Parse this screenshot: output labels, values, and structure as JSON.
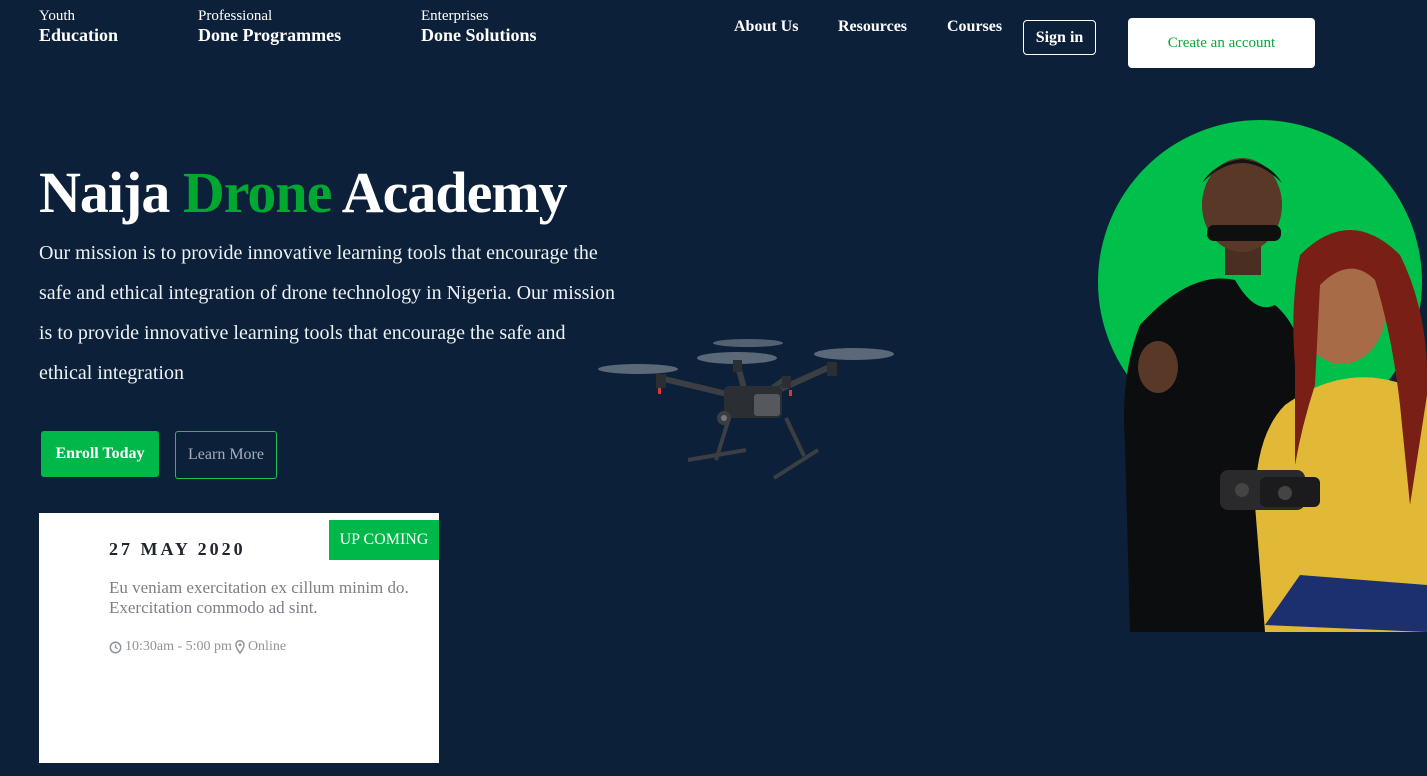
{
  "nav": {
    "groups": [
      {
        "small": "Youth",
        "big": "Education"
      },
      {
        "small": "Professional",
        "big": "Done Programmes"
      },
      {
        "small": "Enterprises",
        "big": "Done Solutions"
      }
    ],
    "links": [
      "About Us",
      "Resources",
      "Courses"
    ],
    "signin": "Sign in",
    "create_account": "Create an account"
  },
  "hero": {
    "title_part1": "Naija",
    "title_part2": "Drone",
    "title_part3": "Academy",
    "description": "Our mission is to provide innovative learning tools that encourage the safe and ethical integration of drone technology in Nigeria. Our mission is to provide innovative learning tools that encourage the safe and ethical integration",
    "enroll": "Enroll Today",
    "learn_more": "Learn More"
  },
  "event": {
    "badge": "UP COMING",
    "date": "27 MAY 2020",
    "description": "Eu veniam exercitation ex cillum minim do. Exercitation commodo ad sint.",
    "time": "10:30am - 5:00 pm",
    "location": "Online"
  },
  "icons": {
    "clock": "clock-icon",
    "location": "map-marker-icon"
  },
  "colors": {
    "background": "#0c2139",
    "accent_green": "#00b84a",
    "title_green": "#00a832",
    "card_bg": "#ffffff"
  }
}
